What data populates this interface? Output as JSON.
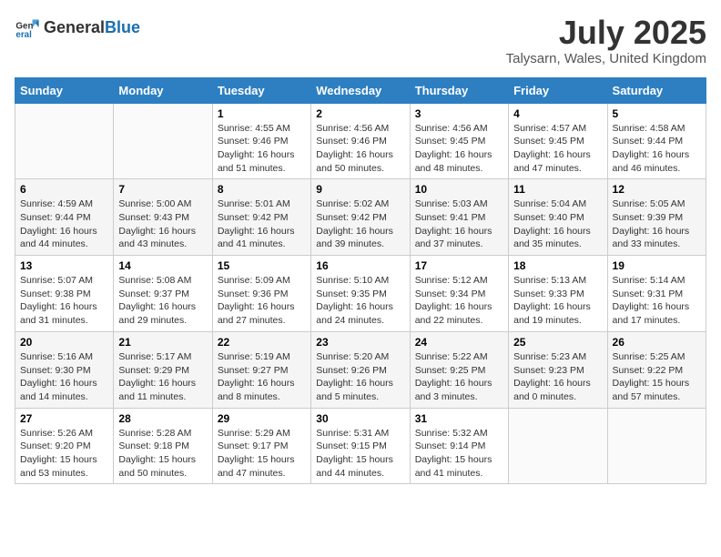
{
  "header": {
    "logo_general": "General",
    "logo_blue": "Blue",
    "month_year": "July 2025",
    "location": "Talysarn, Wales, United Kingdom"
  },
  "days_of_week": [
    "Sunday",
    "Monday",
    "Tuesday",
    "Wednesday",
    "Thursday",
    "Friday",
    "Saturday"
  ],
  "weeks": [
    [
      {
        "day": "",
        "info": ""
      },
      {
        "day": "",
        "info": ""
      },
      {
        "day": "1",
        "info": "Sunrise: 4:55 AM\nSunset: 9:46 PM\nDaylight: 16 hours and 51 minutes."
      },
      {
        "day": "2",
        "info": "Sunrise: 4:56 AM\nSunset: 9:46 PM\nDaylight: 16 hours and 50 minutes."
      },
      {
        "day": "3",
        "info": "Sunrise: 4:56 AM\nSunset: 9:45 PM\nDaylight: 16 hours and 48 minutes."
      },
      {
        "day": "4",
        "info": "Sunrise: 4:57 AM\nSunset: 9:45 PM\nDaylight: 16 hours and 47 minutes."
      },
      {
        "day": "5",
        "info": "Sunrise: 4:58 AM\nSunset: 9:44 PM\nDaylight: 16 hours and 46 minutes."
      }
    ],
    [
      {
        "day": "6",
        "info": "Sunrise: 4:59 AM\nSunset: 9:44 PM\nDaylight: 16 hours and 44 minutes."
      },
      {
        "day": "7",
        "info": "Sunrise: 5:00 AM\nSunset: 9:43 PM\nDaylight: 16 hours and 43 minutes."
      },
      {
        "day": "8",
        "info": "Sunrise: 5:01 AM\nSunset: 9:42 PM\nDaylight: 16 hours and 41 minutes."
      },
      {
        "day": "9",
        "info": "Sunrise: 5:02 AM\nSunset: 9:42 PM\nDaylight: 16 hours and 39 minutes."
      },
      {
        "day": "10",
        "info": "Sunrise: 5:03 AM\nSunset: 9:41 PM\nDaylight: 16 hours and 37 minutes."
      },
      {
        "day": "11",
        "info": "Sunrise: 5:04 AM\nSunset: 9:40 PM\nDaylight: 16 hours and 35 minutes."
      },
      {
        "day": "12",
        "info": "Sunrise: 5:05 AM\nSunset: 9:39 PM\nDaylight: 16 hours and 33 minutes."
      }
    ],
    [
      {
        "day": "13",
        "info": "Sunrise: 5:07 AM\nSunset: 9:38 PM\nDaylight: 16 hours and 31 minutes."
      },
      {
        "day": "14",
        "info": "Sunrise: 5:08 AM\nSunset: 9:37 PM\nDaylight: 16 hours and 29 minutes."
      },
      {
        "day": "15",
        "info": "Sunrise: 5:09 AM\nSunset: 9:36 PM\nDaylight: 16 hours and 27 minutes."
      },
      {
        "day": "16",
        "info": "Sunrise: 5:10 AM\nSunset: 9:35 PM\nDaylight: 16 hours and 24 minutes."
      },
      {
        "day": "17",
        "info": "Sunrise: 5:12 AM\nSunset: 9:34 PM\nDaylight: 16 hours and 22 minutes."
      },
      {
        "day": "18",
        "info": "Sunrise: 5:13 AM\nSunset: 9:33 PM\nDaylight: 16 hours and 19 minutes."
      },
      {
        "day": "19",
        "info": "Sunrise: 5:14 AM\nSunset: 9:31 PM\nDaylight: 16 hours and 17 minutes."
      }
    ],
    [
      {
        "day": "20",
        "info": "Sunrise: 5:16 AM\nSunset: 9:30 PM\nDaylight: 16 hours and 14 minutes."
      },
      {
        "day": "21",
        "info": "Sunrise: 5:17 AM\nSunset: 9:29 PM\nDaylight: 16 hours and 11 minutes."
      },
      {
        "day": "22",
        "info": "Sunrise: 5:19 AM\nSunset: 9:27 PM\nDaylight: 16 hours and 8 minutes."
      },
      {
        "day": "23",
        "info": "Sunrise: 5:20 AM\nSunset: 9:26 PM\nDaylight: 16 hours and 5 minutes."
      },
      {
        "day": "24",
        "info": "Sunrise: 5:22 AM\nSunset: 9:25 PM\nDaylight: 16 hours and 3 minutes."
      },
      {
        "day": "25",
        "info": "Sunrise: 5:23 AM\nSunset: 9:23 PM\nDaylight: 16 hours and 0 minutes."
      },
      {
        "day": "26",
        "info": "Sunrise: 5:25 AM\nSunset: 9:22 PM\nDaylight: 15 hours and 57 minutes."
      }
    ],
    [
      {
        "day": "27",
        "info": "Sunrise: 5:26 AM\nSunset: 9:20 PM\nDaylight: 15 hours and 53 minutes."
      },
      {
        "day": "28",
        "info": "Sunrise: 5:28 AM\nSunset: 9:18 PM\nDaylight: 15 hours and 50 minutes."
      },
      {
        "day": "29",
        "info": "Sunrise: 5:29 AM\nSunset: 9:17 PM\nDaylight: 15 hours and 47 minutes."
      },
      {
        "day": "30",
        "info": "Sunrise: 5:31 AM\nSunset: 9:15 PM\nDaylight: 15 hours and 44 minutes."
      },
      {
        "day": "31",
        "info": "Sunrise: 5:32 AM\nSunset: 9:14 PM\nDaylight: 15 hours and 41 minutes."
      },
      {
        "day": "",
        "info": ""
      },
      {
        "day": "",
        "info": ""
      }
    ]
  ]
}
